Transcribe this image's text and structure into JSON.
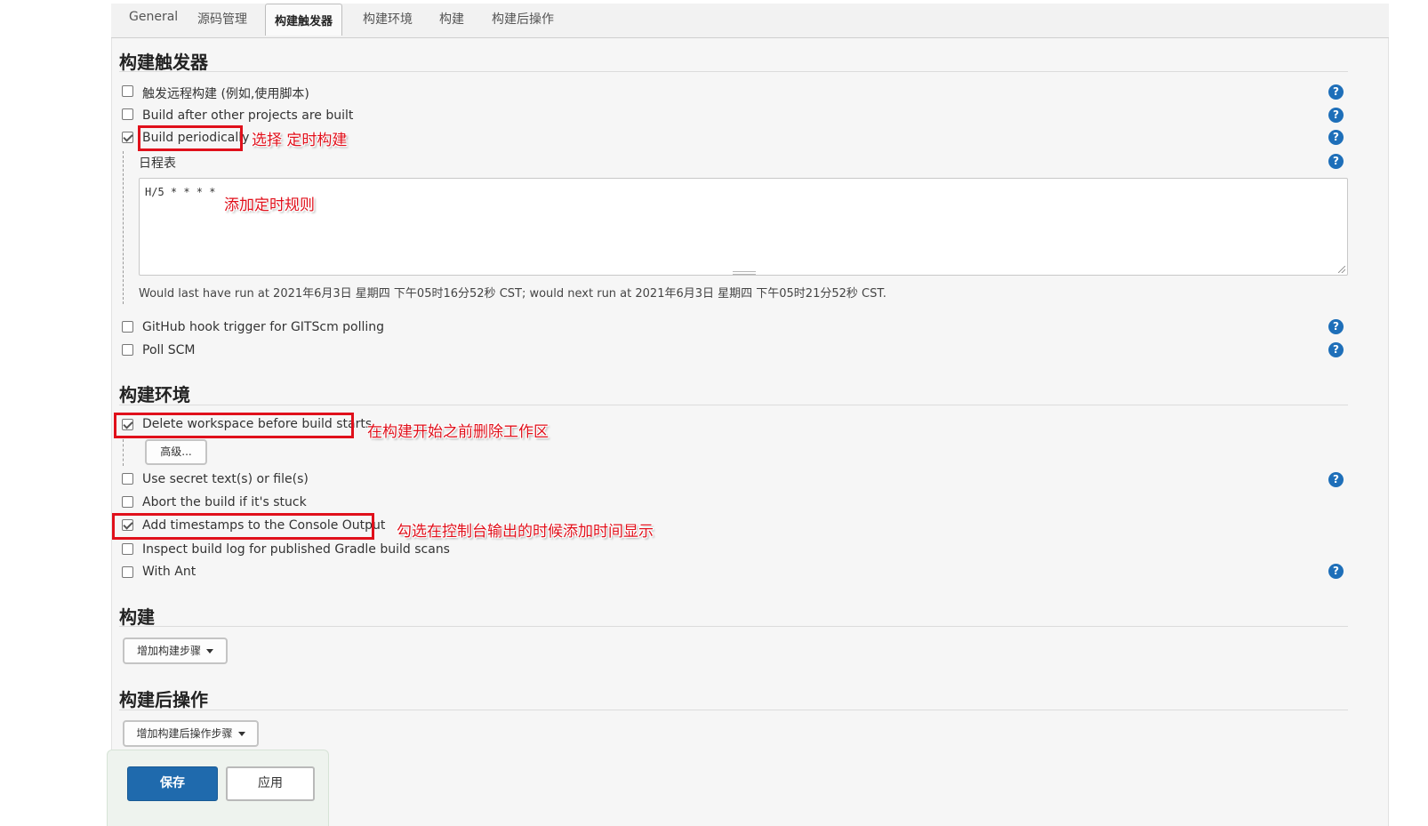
{
  "tabs": [
    "General",
    "源码管理",
    "构建触发器",
    "构建环境",
    "构建",
    "构建后操作"
  ],
  "active_tab": "构建触发器",
  "triggers": {
    "title": "构建触发器",
    "items": [
      {
        "label": "触发远程构建 (例如,使用脚本)",
        "checked": false
      },
      {
        "label": "Build after other projects are built",
        "checked": false
      },
      {
        "label": "Build periodically",
        "checked": true
      },
      {
        "label": "GitHub hook trigger for GITScm polling",
        "checked": false
      },
      {
        "label": "Poll SCM",
        "checked": false
      }
    ],
    "schedule": {
      "label": "日程表",
      "value": "H/5 * * * *",
      "info": "Would last have run at 2021年6月3日 星期四 下午05时16分52秒 CST; would next run at 2021年6月3日 星期四 下午05时21分52秒 CST."
    }
  },
  "environment": {
    "title": "构建环境",
    "items": [
      {
        "label": "Delete workspace before build starts",
        "checked": true
      },
      {
        "label": "Use secret text(s) or file(s)",
        "checked": false
      },
      {
        "label": "Abort the build if it's stuck",
        "checked": false
      },
      {
        "label": "Add timestamps to the Console Output",
        "checked": true
      },
      {
        "label": "Inspect build log for published Gradle build scans",
        "checked": false
      },
      {
        "label": "With Ant",
        "checked": false
      }
    ],
    "advanced_button": "高级..."
  },
  "build": {
    "title": "构建",
    "add_step_button": "增加构建步骤"
  },
  "post_build": {
    "title": "构建后操作",
    "add_step_button": "增加构建后操作步骤"
  },
  "actions": {
    "save": "保存",
    "apply": "应用"
  },
  "annotations": {
    "select_periodic": "选择 定时构建",
    "add_rule": "添加定时规则",
    "delete_workspace": "在构建开始之前删除工作区",
    "timestamps": "勾选在控制台输出的时候添加时间显示"
  },
  "help_icon": "?",
  "colors": {
    "primary": "#1f6aad",
    "help": "#1e6fb9",
    "annotation": "#e0101b"
  }
}
